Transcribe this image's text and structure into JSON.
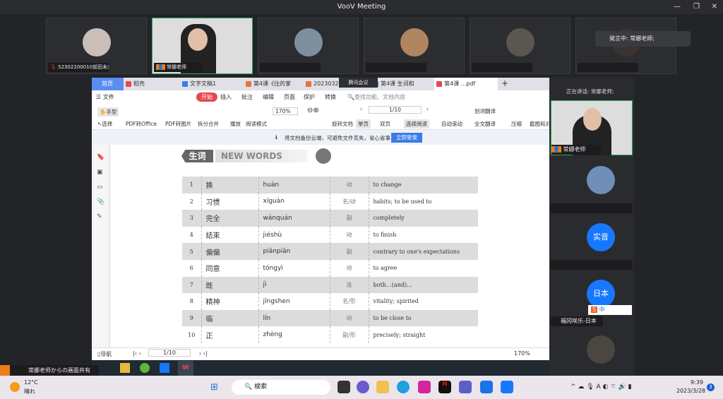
{
  "app": {
    "title": "VooV Meeting"
  },
  "participants": [
    {
      "name": "S2302200010前田未来",
      "muted": true
    },
    {
      "name": "常娜老师",
      "muted": false,
      "host": true
    },
    {
      "name": "",
      "muted": true
    },
    {
      "name": "",
      "muted": false
    },
    {
      "name": "",
      "muted": true
    },
    {
      "name": "",
      "muted": true
    }
  ],
  "speaking_toast": "発言中: 常娜老師;",
  "wps": {
    "tabs": [
      "首页",
      "稻壳",
      "文字文稿1",
      "第4课《往的爹",
      "20230321",
      "第4课 生词和",
      "第4课 ...pdf"
    ],
    "overlay_tag": "腾讯会议",
    "menu": [
      "文件",
      "开始",
      "插入",
      "批注",
      "编辑",
      "页面",
      "保护",
      "转换"
    ],
    "search_placeholder": "查找功能、文档内容",
    "ribbon": [
      "手型",
      "选择",
      "PDF转Office",
      "PDF转图片",
      "拆分合并",
      "播放",
      "阅读模式",
      "旋转文档",
      "单页",
      "双页",
      "连续阅读",
      "自动滚动",
      "划词翻译",
      "全文翻译",
      "压缩",
      "截图和对比"
    ],
    "zoom": "170%",
    "page": "1/10",
    "notice": "将文档备份云端，可避免文件丢失，省心省事",
    "login_button": "立即登录",
    "status": {
      "nav": "导航",
      "page": "1/10",
      "zoom": "170%"
    }
  },
  "document": {
    "banner_cn": "生词",
    "banner_en": "NEW WORDS",
    "words": [
      {
        "n": "1",
        "hanzi": "换",
        "pinyin": "huàn",
        "pos": "动",
        "meaning": "to change"
      },
      {
        "n": "2",
        "hanzi": "习惯",
        "pinyin": "xíguàn",
        "pos": "名/动",
        "meaning": "habits; to be used to"
      },
      {
        "n": "3",
        "hanzi": "完全",
        "pinyin": "wánquán",
        "pos": "副",
        "meaning": "completely"
      },
      {
        "n": "4",
        "hanzi": "结束",
        "pinyin": "jiéshù",
        "pos": "动",
        "meaning": "to finish"
      },
      {
        "n": "5",
        "hanzi": "偏偏",
        "pinyin": "piānpiān",
        "pos": "副",
        "meaning": "contrary to one's expectations"
      },
      {
        "n": "6",
        "hanzi": "同意",
        "pinyin": "tóngyì",
        "pos": "动",
        "meaning": "to agree"
      },
      {
        "n": "7",
        "hanzi": "既",
        "pinyin": "jì",
        "pos": "连",
        "meaning": "both…(and)…"
      },
      {
        "n": "8",
        "hanzi": "精神",
        "pinyin": "jīngshen",
        "pos": "名/形",
        "meaning": "vitality; spirited"
      },
      {
        "n": "9",
        "hanzi": "临",
        "pinyin": "lín",
        "pos": "动",
        "meaning": "to be close to"
      },
      {
        "n": "10",
        "hanzi": "正",
        "pinyin": "zhèng",
        "pos": "副/形",
        "meaning": "precisely; straight"
      }
    ]
  },
  "right_panel": {
    "now_speaking": "正在讲话: 常娜老师;",
    "host_name": "常娜老师",
    "avatars": [
      {
        "label": "实音"
      },
      {
        "label": "日本"
      }
    ],
    "named": "福冈咲乐-日本",
    "ime": "中"
  },
  "share_label": "常娜老师からの画面共有",
  "taskbar": {
    "weather_temp": "12°C",
    "weather_desc": "晴れ",
    "search": "検索",
    "time": "9:39",
    "date": "2023/3/28",
    "badge": "3"
  },
  "colors": {
    "accent": "#1677ff",
    "active_border": "#2aa55a",
    "wps_red": "#e5484d"
  }
}
